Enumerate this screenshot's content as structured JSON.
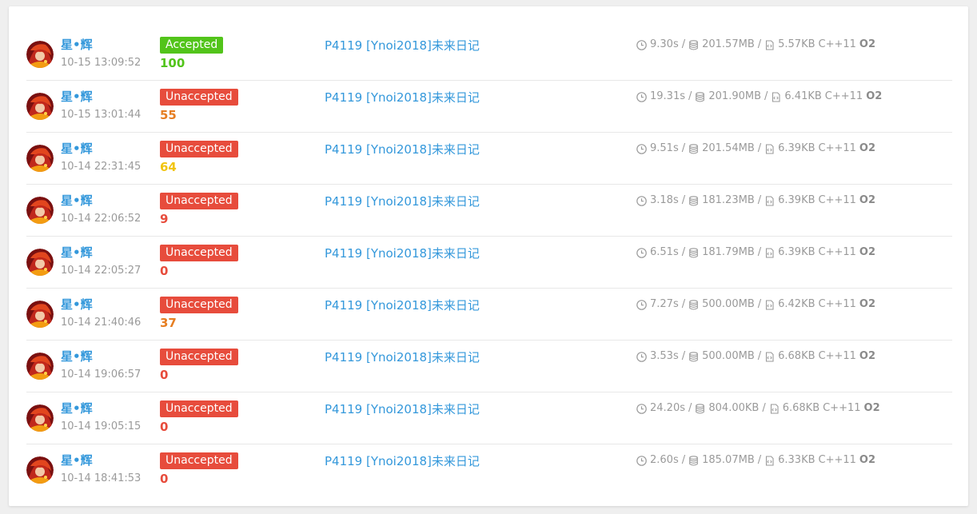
{
  "colors": {
    "accepted": "#52c41a",
    "unaccepted": "#e74c3c",
    "link": "#3498db",
    "score_green": "#52c41a",
    "score_orange": "#e67e22",
    "score_yellow": "#f1c40f",
    "score_red": "#e74c3c"
  },
  "records": [
    {
      "user": "星•辉",
      "time": "10-15 13:09:52",
      "status": "Accepted",
      "status_kind": "accepted",
      "score": "100",
      "score_color": "score_green",
      "problem": "P4119 [Ynoi2018]未来日记",
      "runtime": "9.30s",
      "memory": "201.57MB",
      "code_size": "5.57KB",
      "language": "C++11",
      "opt": "O2"
    },
    {
      "user": "星•辉",
      "time": "10-15 13:01:44",
      "status": "Unaccepted",
      "status_kind": "unaccepted",
      "score": "55",
      "score_color": "score_orange",
      "problem": "P4119 [Ynoi2018]未来日记",
      "runtime": "19.31s",
      "memory": "201.90MB",
      "code_size": "6.41KB",
      "language": "C++11",
      "opt": "O2"
    },
    {
      "user": "星•辉",
      "time": "10-14 22:31:45",
      "status": "Unaccepted",
      "status_kind": "unaccepted",
      "score": "64",
      "score_color": "score_yellow",
      "problem": "P4119 [Ynoi2018]未来日记",
      "runtime": "9.51s",
      "memory": "201.54MB",
      "code_size": "6.39KB",
      "language": "C++11",
      "opt": "O2"
    },
    {
      "user": "星•辉",
      "time": "10-14 22:06:52",
      "status": "Unaccepted",
      "status_kind": "unaccepted",
      "score": "9",
      "score_color": "score_red",
      "problem": "P4119 [Ynoi2018]未来日记",
      "runtime": "3.18s",
      "memory": "181.23MB",
      "code_size": "6.39KB",
      "language": "C++11",
      "opt": "O2"
    },
    {
      "user": "星•辉",
      "time": "10-14 22:05:27",
      "status": "Unaccepted",
      "status_kind": "unaccepted",
      "score": "0",
      "score_color": "score_red",
      "problem": "P4119 [Ynoi2018]未来日记",
      "runtime": "6.51s",
      "memory": "181.79MB",
      "code_size": "6.39KB",
      "language": "C++11",
      "opt": "O2"
    },
    {
      "user": "星•辉",
      "time": "10-14 21:40:46",
      "status": "Unaccepted",
      "status_kind": "unaccepted",
      "score": "37",
      "score_color": "score_orange",
      "problem": "P4119 [Ynoi2018]未来日记",
      "runtime": "7.27s",
      "memory": "500.00MB",
      "code_size": "6.42KB",
      "language": "C++11",
      "opt": "O2"
    },
    {
      "user": "星•辉",
      "time": "10-14 19:06:57",
      "status": "Unaccepted",
      "status_kind": "unaccepted",
      "score": "0",
      "score_color": "score_red",
      "problem": "P4119 [Ynoi2018]未来日记",
      "runtime": "3.53s",
      "memory": "500.00MB",
      "code_size": "6.68KB",
      "language": "C++11",
      "opt": "O2"
    },
    {
      "user": "星•辉",
      "time": "10-14 19:05:15",
      "status": "Unaccepted",
      "status_kind": "unaccepted",
      "score": "0",
      "score_color": "score_red",
      "problem": "P4119 [Ynoi2018]未来日记",
      "runtime": "24.20s",
      "memory": "804.00KB",
      "code_size": "6.68KB",
      "language": "C++11",
      "opt": "O2"
    },
    {
      "user": "星•辉",
      "time": "10-14 18:41:53",
      "status": "Unaccepted",
      "status_kind": "unaccepted",
      "score": "0",
      "score_color": "score_red",
      "problem": "P4119 [Ynoi2018]未来日记",
      "runtime": "2.60s",
      "memory": "185.07MB",
      "code_size": "6.33KB",
      "language": "C++11",
      "opt": "O2"
    }
  ],
  "icons": {
    "avatar": "avatar-image",
    "runtime": "clock-icon",
    "memory": "database-icon",
    "code_size": "file-code-icon"
  }
}
